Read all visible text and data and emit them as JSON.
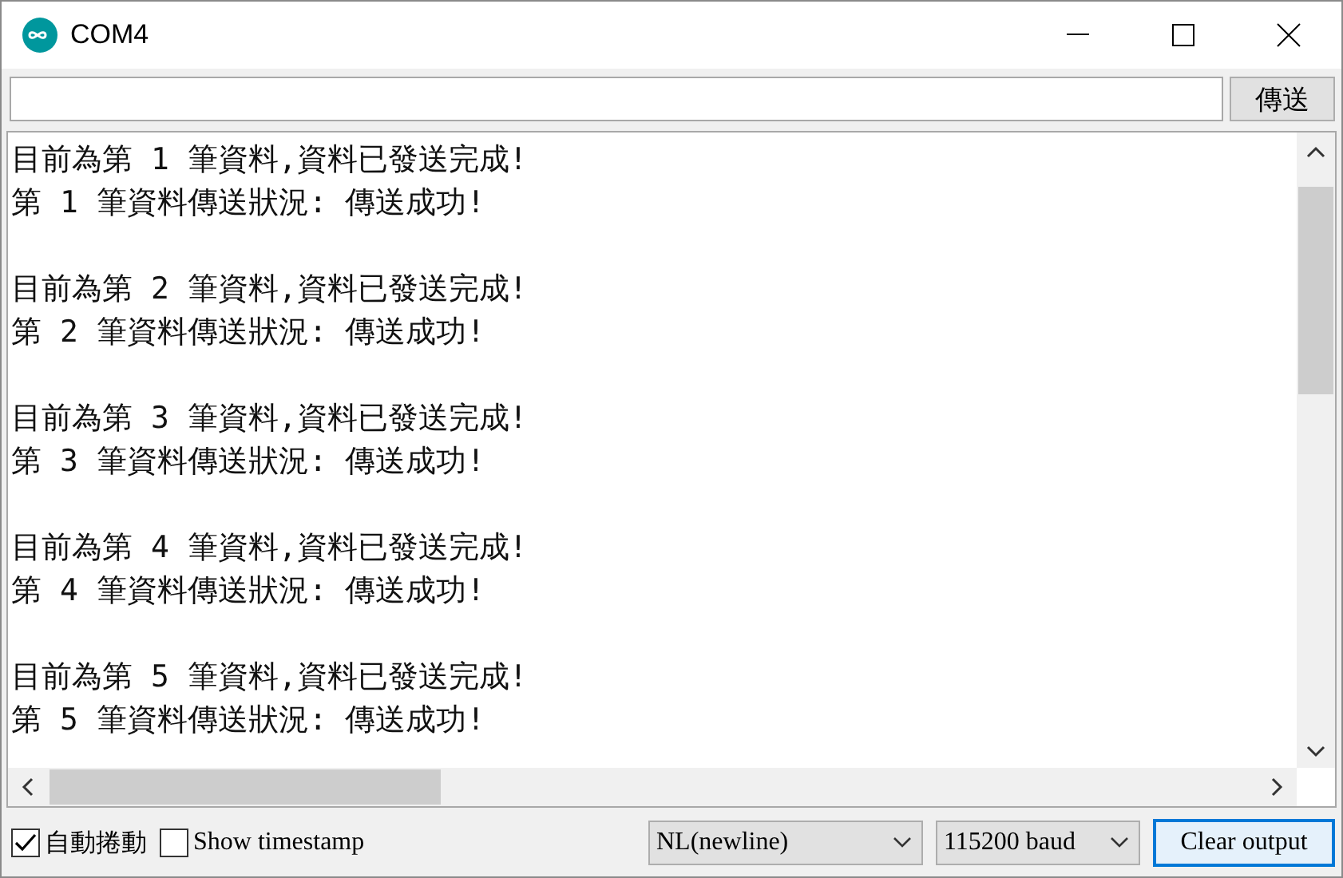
{
  "window": {
    "title": "COM4"
  },
  "send": {
    "button": "傳送"
  },
  "output": {
    "blocks": [
      {
        "lines": [
          "目前為第 1 筆資料,資料已發送完成!",
          "第 1 筆資料傳送狀況: 傳送成功!"
        ]
      },
      {
        "lines": [
          "目前為第 2 筆資料,資料已發送完成!",
          "第 2 筆資料傳送狀況: 傳送成功!"
        ]
      },
      {
        "lines": [
          "目前為第 3 筆資料,資料已發送完成!",
          "第 3 筆資料傳送狀況: 傳送成功!"
        ]
      },
      {
        "lines": [
          "目前為第 4 筆資料,資料已發送完成!",
          "第 4 筆資料傳送狀況: 傳送成功!"
        ]
      },
      {
        "lines": [
          "目前為第 5 筆資料,資料已發送完成!",
          "第 5 筆資料傳送狀況: 傳送成功!"
        ]
      }
    ]
  },
  "footer": {
    "checkboxes": [
      {
        "label": "自動捲動",
        "checked": true
      },
      {
        "label": "Show timestamp",
        "checked": false
      }
    ],
    "line_ending": "NL(newline)",
    "baud": "115200 baud",
    "clear_button": "Clear output"
  }
}
